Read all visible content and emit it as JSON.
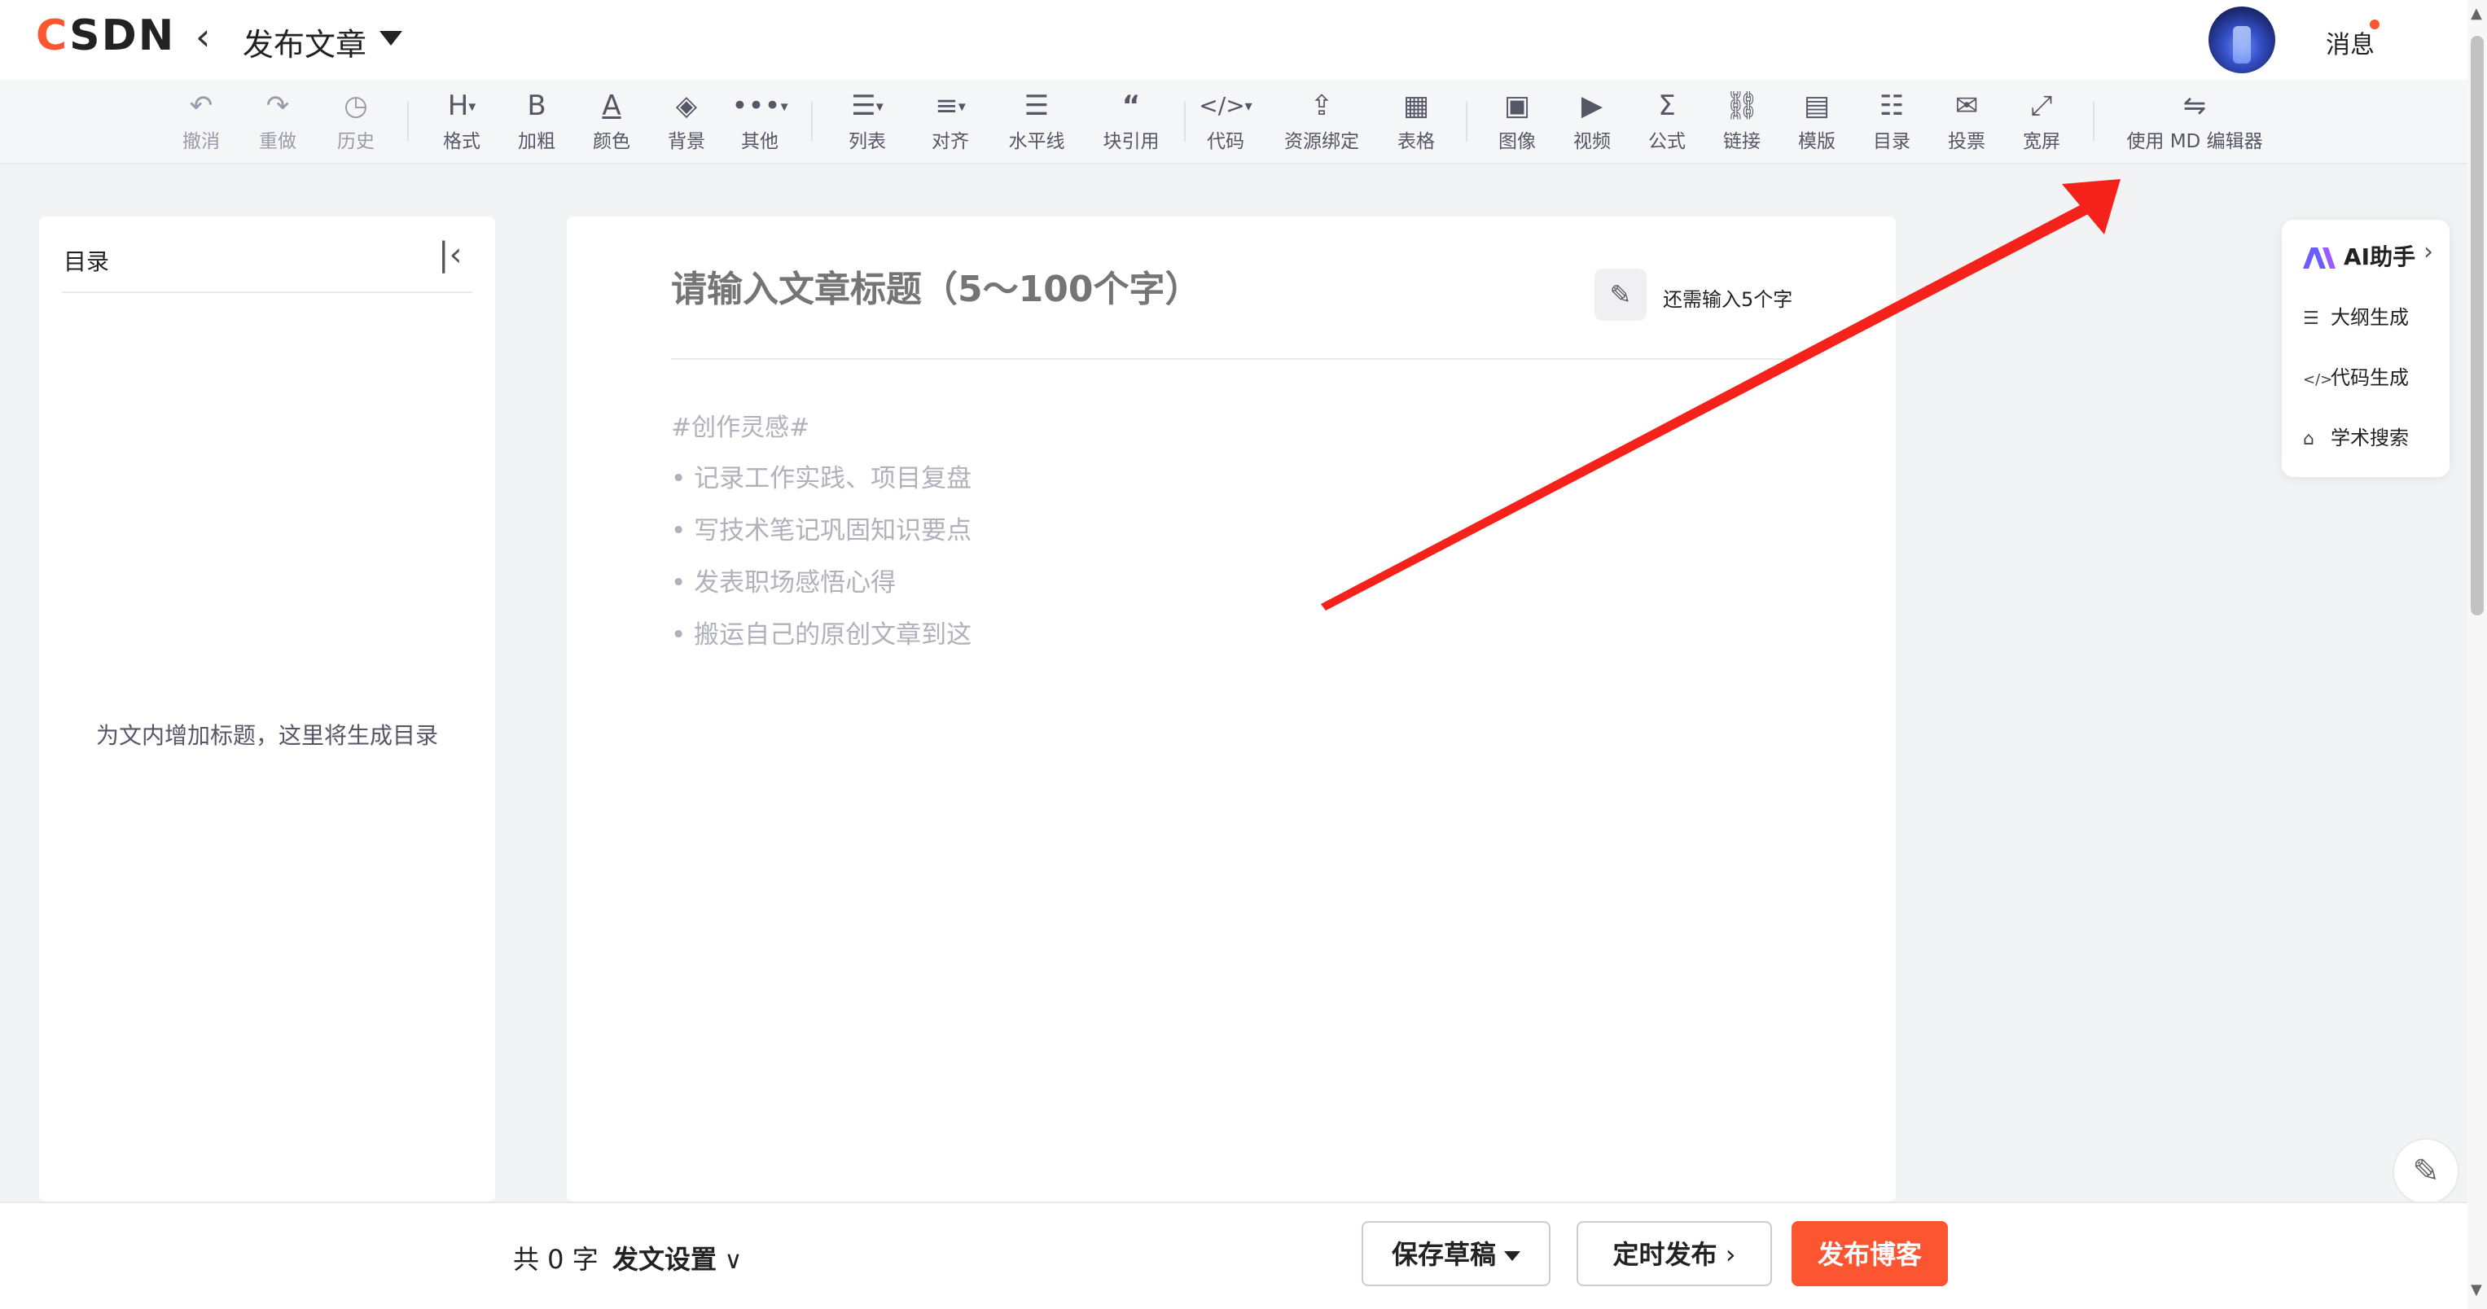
{
  "header": {
    "logo_text": "CSDN",
    "back_icon": "chevron-left-icon",
    "page_title": "发布文章",
    "messages_label": "消息"
  },
  "toolbar": {
    "undo": "撤消",
    "redo": "重做",
    "history": "历史",
    "format": "格式",
    "bold": "加粗",
    "color": "颜色",
    "background": "背景",
    "other": "其他",
    "list": "列表",
    "align": "对齐",
    "hr": "水平线",
    "quote": "块引用",
    "code": "代码",
    "resource": "资源绑定",
    "table": "表格",
    "image": "图像",
    "video": "视频",
    "formula": "公式",
    "link": "链接",
    "template": "模版",
    "toc": "目录",
    "vote": "投票",
    "wide": "宽屏",
    "md_editor": "使用 MD 编辑器"
  },
  "toc": {
    "title": "目录",
    "empty": "为文内增加标题，这里将生成目录"
  },
  "editor": {
    "title_placeholder": "请输入文章标题（5～100个字）",
    "need_input": "还需输入5个字",
    "inspiration_tag": "#创作灵感#",
    "inspiration_items": [
      "• 记录工作实践、项目复盘",
      "• 写技术笔记巩固知识要点",
      "• 发表职场感悟心得",
      "• 搬运自己的原创文章到这"
    ]
  },
  "ai": {
    "title": "AI助手",
    "items": [
      "大纲生成",
      "代码生成",
      "学术搜索"
    ]
  },
  "footer": {
    "count": "共 0 字",
    "settings": "发文设置",
    "save_draft": "保存草稿",
    "scheduled": "定时发布",
    "publish": "发布博客"
  },
  "colors": {
    "brand": "#fc5531",
    "annotation_arrow": "#f5221b"
  }
}
